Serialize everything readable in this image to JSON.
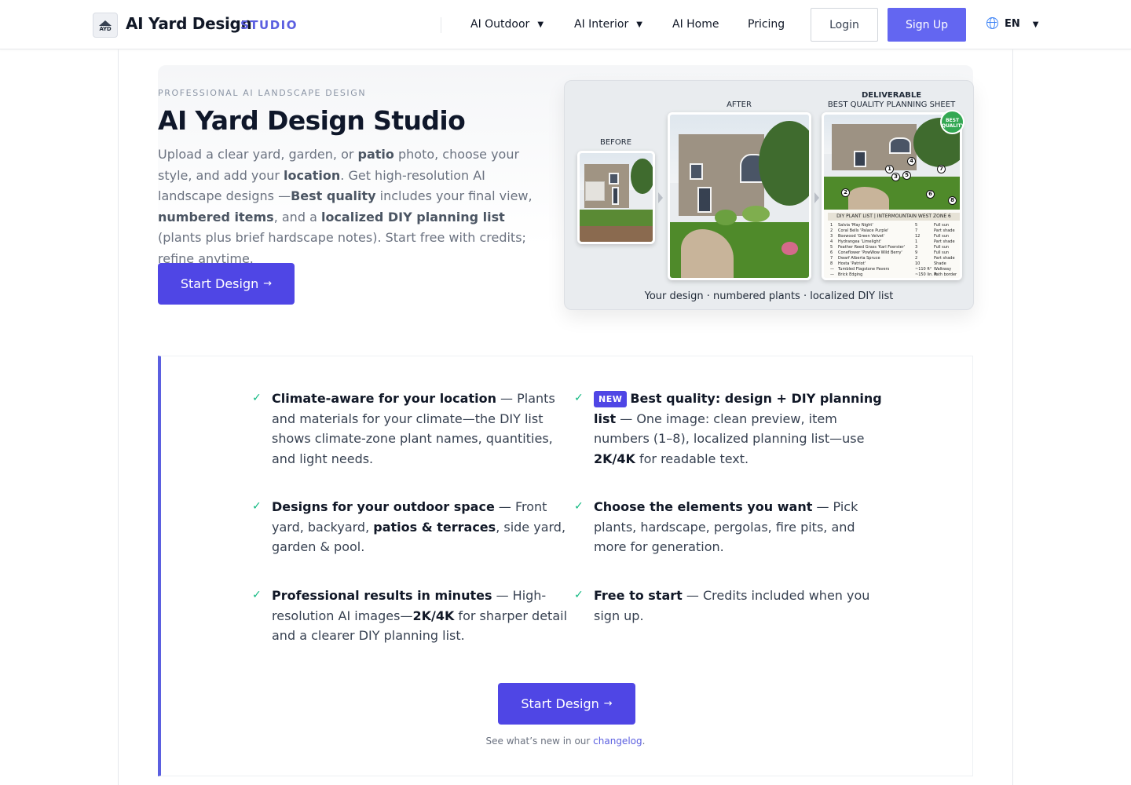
{
  "nav": {
    "logo_abbr": "AYD",
    "brand": "AI Yard Design",
    "brand_sub": "STUDIO",
    "links": [
      {
        "label": "AI Outdoor",
        "caret": "▼"
      },
      {
        "label": "AI Interior",
        "caret": "▼"
      },
      {
        "label": "AI Home"
      },
      {
        "label": "Pricing"
      }
    ],
    "login": "Login",
    "signup": "Sign Up",
    "language": "EN",
    "language_caret": "▼",
    "icons": {
      "language": "globe-icon",
      "menu_caret": "caret-down-icon"
    },
    "accent": "#5b5fe0"
  },
  "hero": {
    "eyebrow": "PROFESSIONAL AI LANDSCAPE DESIGN",
    "title": "AI Yard Design Studio",
    "desc": [
      {
        "t": "Upload a clear yard, garden, or "
      },
      {
        "t": "patio",
        "b": true
      },
      {
        "t": " photo, choose your style, and add your "
      },
      {
        "t": "location",
        "b": true
      },
      {
        "t": ". Get high-resolution AI landscape designs —"
      },
      {
        "t": "Best quality",
        "b": true
      },
      {
        "t": " includes your final view, "
      },
      {
        "t": "numbered items",
        "b": true
      },
      {
        "t": ", and a "
      },
      {
        "t": "localized DIY planning list",
        "b": true
      },
      {
        "t": " (plants plus brief hardscape notes). Start free with credits; refine anytime."
      }
    ],
    "cta": "Start Design",
    "cta_arrow": "→",
    "button_color": "#4f46e5"
  },
  "preview": {
    "before_label": "BEFORE",
    "after_label": "AFTER",
    "deliverable_label": "DELIVERABLE",
    "deliverable_sub": "BEST QUALITY PLANNING SHEET",
    "badge_line1": "BEST",
    "badge_line2": "QUALITY",
    "numbers": [
      "1",
      "2",
      "3",
      "4",
      "5",
      "6",
      "7",
      "8"
    ],
    "sheet_title": "DIY PLANT LIST | INTERMOUNTAIN WEST ZONE 6",
    "sheet_rows": [
      [
        "1",
        "Salvia 'May Night'",
        "5",
        "Full sun"
      ],
      [
        "2",
        "Coral Bells 'Palace Purple'",
        "7",
        "Part shade"
      ],
      [
        "3",
        "Boxwood 'Green Velvet'",
        "12",
        "Full sun"
      ],
      [
        "4",
        "Hydrangea 'Limelight'",
        "1",
        "Part shade"
      ],
      [
        "5",
        "Feather Reed Grass 'Karl Foerster'",
        "3",
        "Full sun"
      ],
      [
        "6",
        "Coneflower 'PowWow Wild Berry'",
        "9",
        "Full sun"
      ],
      [
        "7",
        "Dwarf Alberta Spruce",
        "2",
        "Part shade"
      ],
      [
        "8",
        "Hosta 'Patriot'",
        "10",
        "Shade"
      ],
      [
        "—",
        "Tumbled Flagstone Pavers",
        "~110 ft²",
        "Walkway"
      ],
      [
        "—",
        "Brick Edging",
        "~150 lin. ft.",
        "Path border"
      ]
    ],
    "caption": "Your design · numbered plants · localized DIY list"
  },
  "features": {
    "items": [
      {
        "parts": [
          {
            "t": "Climate-aware for your location",
            "b": true
          },
          {
            "t": " — Plants and materials for your climate—the DIY list shows climate-zone plant names, quantities, and light needs."
          }
        ]
      },
      {
        "badge": "NEW",
        "parts": [
          {
            "t": "Best quality: design + DIY planning list",
            "b": true
          },
          {
            "t": " — One image: clean preview, item numbers (1–8), localized planning list—use "
          },
          {
            "t": "2K/4K",
            "b": true
          },
          {
            "t": " for readable text."
          }
        ]
      },
      {
        "parts": [
          {
            "t": "Designs for your outdoor space",
            "b": true
          },
          {
            "t": " — Front yard, backyard, "
          },
          {
            "t": "patios & terraces",
            "b": true
          },
          {
            "t": ", side yard, garden & pool."
          }
        ]
      },
      {
        "parts": [
          {
            "t": "Choose the elements you want",
            "b": true
          },
          {
            "t": " — Pick plants, hardscape, pergolas, fire pits, and more for generation."
          }
        ]
      },
      {
        "parts": [
          {
            "t": "Professional results in minutes",
            "b": true
          },
          {
            "t": " — High-resolution AI images—"
          },
          {
            "t": "2K/4K",
            "b": true
          },
          {
            "t": " for sharper detail and a clearer DIY planning list."
          }
        ]
      },
      {
        "parts": [
          {
            "t": "Free to start",
            "b": true
          },
          {
            "t": " — Credits included when you sign up."
          }
        ]
      }
    ],
    "check_glyph": "✓",
    "check_color": "#10b981",
    "cta": "Start Design",
    "cta_arrow": "→",
    "changelog_prefix": "See what’s new in our ",
    "changelog_link": "changelog",
    "changelog_suffix": "."
  }
}
